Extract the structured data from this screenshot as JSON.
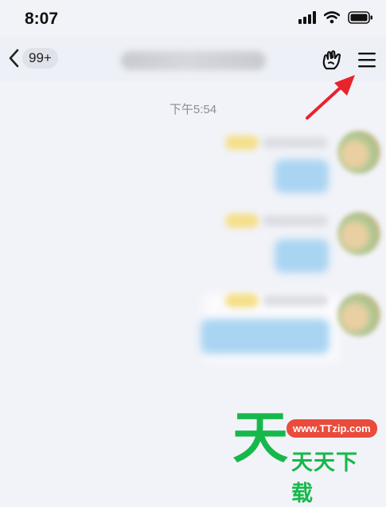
{
  "status_bar": {
    "time": "8:07",
    "icons": [
      "signal-icon",
      "wifi-icon",
      "battery-icon"
    ]
  },
  "nav": {
    "back_icon": "chevron-left-icon",
    "unread_badge": "99+",
    "title": "",
    "title_blurred": true,
    "right_icons": [
      "hand-gesture-icon",
      "menu-icon"
    ]
  },
  "chat": {
    "timestamp": "下午5:54",
    "messages": [
      {
        "text": "",
        "blurred": true
      },
      {
        "text": "",
        "blurred": true
      },
      {
        "text": "",
        "blurred": true
      }
    ]
  },
  "annotation": {
    "type": "red-arrow",
    "points_to": "menu-icon",
    "color": "#e8232a"
  },
  "watermark": {
    "big_char": "天",
    "url": "www.TTzip.com",
    "sub": "天天下载",
    "colors": {
      "green": "#17b84b",
      "red": "#e94b3c"
    }
  }
}
